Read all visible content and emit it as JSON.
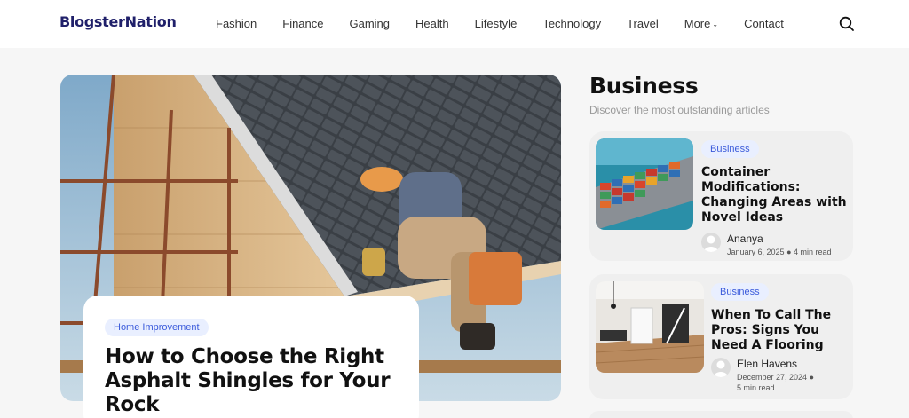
{
  "header": {
    "logo": "BlogsterNation",
    "nav": [
      "Fashion",
      "Finance",
      "Gaming",
      "Health",
      "Lifestyle",
      "Technology",
      "Travel",
      "More",
      "Contact"
    ]
  },
  "hero": {
    "category": "Home Improvement",
    "title": "How to Choose the Right Asphalt Shingles for Your Rock"
  },
  "sidebar": {
    "title": "Business",
    "subtitle": "Discover the most outstanding articles",
    "posts": [
      {
        "category": "Business",
        "title": "Container Modifications: Changing Areas with Novel Ideas",
        "author": "Ananya",
        "date": "January 6, 2025",
        "read_time": "4 min read"
      },
      {
        "category": "Business",
        "title": "When To Call The Pros: Signs You Need A Flooring",
        "author": "Elen Havens",
        "date": "December 27, 2024",
        "read_time": "5 min read"
      }
    ]
  },
  "colors": {
    "logo": "#20206a",
    "chip_text": "#3b5bdb",
    "chip_bg": "#e9efff",
    "card_bg": "#efefef"
  }
}
